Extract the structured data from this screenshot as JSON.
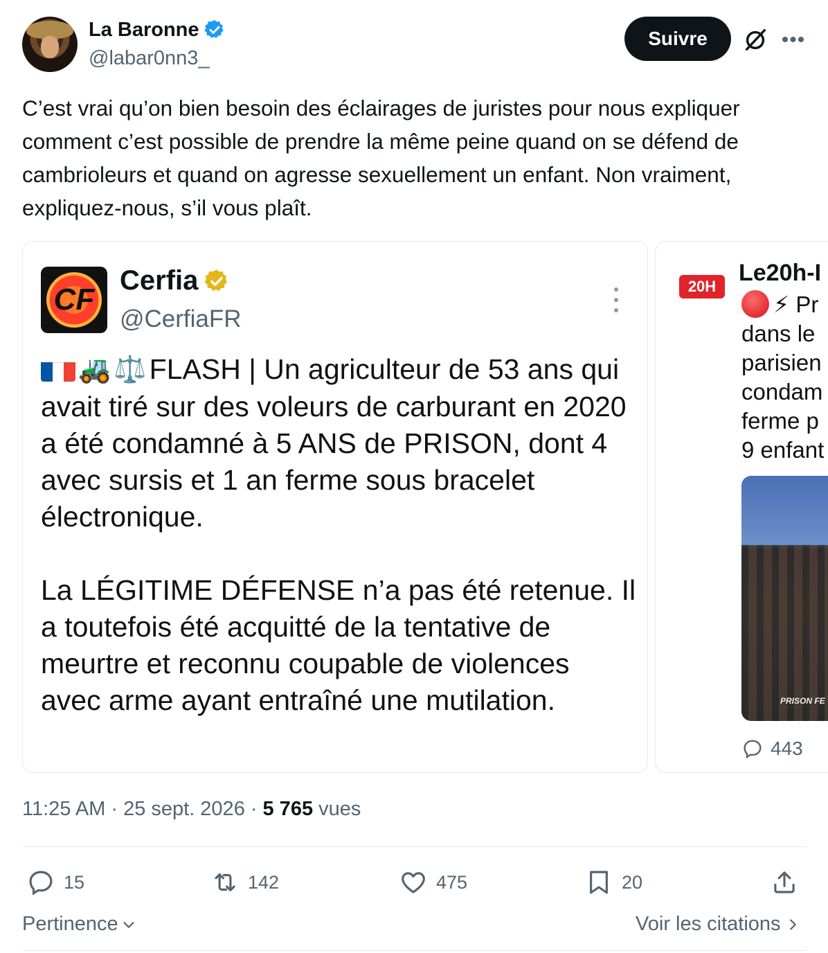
{
  "author": {
    "name": "La Baronne",
    "handle": "@labar0nn3_",
    "follow_label": "Suivre"
  },
  "tweet": {
    "text": "C’est vrai qu’on bien besoin des éclairages de juristes pour nous expliquer comment c’est possible de prendre la même peine quand on se défend de cambrioleurs et quand on agresse sexuellement un enfant. Non vraiment, expliquez-nous, s’il vous plaît.",
    "time": "11:25 AM",
    "date": "25 sept. 2026",
    "separator": "·",
    "views": "5 765",
    "views_label": "vues"
  },
  "quoted1": {
    "logo_text": "CF",
    "name": "Cerfia",
    "handle": "@CerfiaFR",
    "paragraph1": "FLASH | Un agriculteur de 53 ans qui avait tiré sur des voleurs de carburant en 2020 a été condamné à 5 ANS de PRISON, dont 4 avec sursis et 1 an ferme sous bracelet électronique.",
    "paragraph2": "La LÉGITIME DÉFENSE n’a pas été retenue. Il a toutefois été acquitté de la tentative de meurtre et reconnu coupable de violences avec arme ayant entraîné une mutilation.",
    "emoji": [
      "🚜",
      "⚖️"
    ]
  },
  "quoted2": {
    "badge": "20H",
    "name": "Le20h-I",
    "lines": [
      "⚡ Pr",
      "dans le",
      "parisien",
      "condam",
      "ferme p",
      "9 enfant"
    ],
    "photo_caption": "PRISON FE",
    "reply_count": "443"
  },
  "actions": {
    "reply": "15",
    "repost": "142",
    "like": "475",
    "bookmark": "20"
  },
  "footer": {
    "sort_label": "Pertinence",
    "quotes_label": "Voir les citations"
  },
  "colors": {
    "follow_bg": "#0f1419",
    "secondary_text": "#536471",
    "verified_blue": "#1d9bf0",
    "verified_gold": "#e2b719",
    "badge_red": "#e0242a"
  }
}
